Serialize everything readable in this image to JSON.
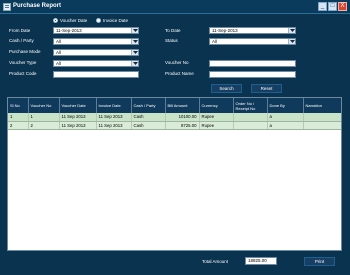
{
  "window": {
    "title": "Purchase Report",
    "minimize": "_",
    "maximize": "□",
    "close": "X"
  },
  "date_mode": {
    "voucher_date": "Voucher Date",
    "invoice_date": "Invoice Date",
    "selected": "voucher_date"
  },
  "filters": {
    "from_date_label": "From Date",
    "from_date_value": "11-Sep-2013",
    "to_date_label": "To Date",
    "to_date_value": "11-Sep-2013",
    "cash_party_label": "Cash / Party",
    "cash_party_value": "All",
    "status_label": "Status",
    "status_value": "All",
    "purchase_mode_label": "Purchase Mode",
    "purchase_mode_value": "All",
    "voucher_type_label": "Voucher Type",
    "voucher_type_value": "All",
    "voucher_no_label": "Voucher No",
    "voucher_no_value": "",
    "product_code_label": "Product Code",
    "product_code_value": "",
    "product_name_label": "Product Name",
    "product_name_value": ""
  },
  "buttons": {
    "search": "Search",
    "reset": "Reset",
    "print": "Print"
  },
  "table": {
    "columns": [
      "Sl No",
      "Voucher No",
      "Voucher Date",
      "Invoice Date",
      "Cash / Party",
      "Bill Amount",
      "Currency",
      "Order No / Receipt No",
      "Done By",
      "Narration"
    ],
    "rows": [
      [
        "1",
        "1",
        "11 Sep 2013",
        "11 Sep 2013",
        "Cash",
        "10100.00",
        "Rupee",
        "",
        "a",
        ""
      ],
      [
        "2",
        "2",
        "11 Sep 2013",
        "11 Sep 2013",
        "Cash",
        "8725.00",
        "Rupee",
        "",
        "a",
        ""
      ]
    ]
  },
  "total": {
    "label": "Total Amount",
    "value": "18825.00"
  }
}
